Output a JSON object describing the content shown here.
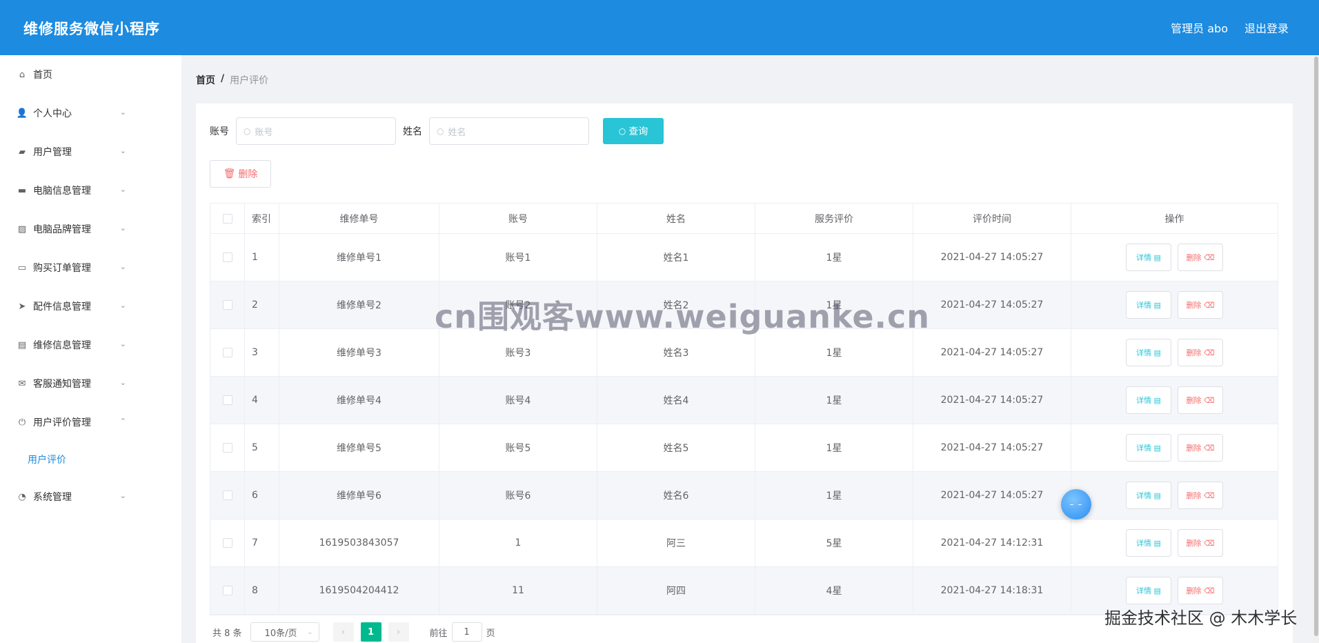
{
  "header": {
    "title": "维修服务微信小程序",
    "admin": "管理员 abo",
    "logout": "退出登录"
  },
  "sidebar": {
    "items": [
      {
        "label": "首页",
        "icon": "home-icon",
        "glyph": "⌂",
        "chevron": ""
      },
      {
        "label": "个人中心",
        "icon": "user-icon",
        "glyph": "👤",
        "chevron": "⌄"
      },
      {
        "label": "用户管理",
        "icon": "wallet-icon",
        "glyph": "▰",
        "chevron": "⌄"
      },
      {
        "label": "电脑信息管理",
        "icon": "briefcase-icon",
        "glyph": "▬",
        "chevron": "⌄"
      },
      {
        "label": "电脑品牌管理",
        "icon": "chart-icon",
        "glyph": "▨",
        "chevron": "⌄"
      },
      {
        "label": "购买订单管理",
        "icon": "ticket-icon",
        "glyph": "▭",
        "chevron": "⌄"
      },
      {
        "label": "配件信息管理",
        "icon": "send-icon",
        "glyph": "➤",
        "chevron": "⌄"
      },
      {
        "label": "维修信息管理",
        "icon": "clipboard-icon",
        "glyph": "▤",
        "chevron": "⌄"
      },
      {
        "label": "客服通知管理",
        "icon": "mail-icon",
        "glyph": "✉",
        "chevron": "⌄"
      },
      {
        "label": "用户评价管理",
        "icon": "power-icon",
        "glyph": "⏻",
        "chevron": "⌃"
      },
      {
        "label": "系统管理",
        "icon": "gauge-icon",
        "glyph": "◔",
        "chevron": "⌄"
      }
    ],
    "sub_item": "用户评价"
  },
  "breadcrumb": {
    "home": "首页",
    "sep": "/",
    "current": "用户评价"
  },
  "search": {
    "account_label": "账号",
    "account_placeholder": "账号",
    "name_label": "姓名",
    "name_placeholder": "姓名",
    "query_button": "查询",
    "delete_button": "删除"
  },
  "table": {
    "headers": [
      "索引",
      "维修单号",
      "账号",
      "姓名",
      "服务评价",
      "评价时间",
      "操作"
    ],
    "rows": [
      {
        "idx": "1",
        "no": "维修单号1",
        "account": "账号1",
        "name": "姓名1",
        "rating": "1星",
        "time": "2021-04-27 14:05:27"
      },
      {
        "idx": "2",
        "no": "维修单号2",
        "account": "账号2",
        "name": "姓名2",
        "rating": "1星",
        "time": "2021-04-27 14:05:27"
      },
      {
        "idx": "3",
        "no": "维修单号3",
        "account": "账号3",
        "name": "姓名3",
        "rating": "1星",
        "time": "2021-04-27 14:05:27"
      },
      {
        "idx": "4",
        "no": "维修单号4",
        "account": "账号4",
        "name": "姓名4",
        "rating": "1星",
        "time": "2021-04-27 14:05:27"
      },
      {
        "idx": "5",
        "no": "维修单号5",
        "account": "账号5",
        "name": "姓名5",
        "rating": "1星",
        "time": "2021-04-27 14:05:27"
      },
      {
        "idx": "6",
        "no": "维修单号6",
        "account": "账号6",
        "name": "姓名6",
        "rating": "1星",
        "time": "2021-04-27 14:05:27"
      },
      {
        "idx": "7",
        "no": "1619503843057",
        "account": "1",
        "name": "阿三",
        "rating": "5星",
        "time": "2021-04-27 14:12:31"
      },
      {
        "idx": "8",
        "no": "1619504204412",
        "account": "11",
        "name": "阿四",
        "rating": "4星",
        "time": "2021-04-27 14:18:31"
      }
    ],
    "detail_label": "详情 ▤",
    "remove_label": "删除 ⌫"
  },
  "pagination": {
    "total": "共 8 条",
    "page_size": "10条/页",
    "prev": "‹",
    "current_page": "1",
    "next": "›",
    "goto_label": "前往",
    "goto_value": "1",
    "page_suffix": "页"
  },
  "overlays": {
    "watermark": "cn围观客www.weiguanke.cn",
    "corner_text": "掘金技术社区 @ 木木学长"
  },
  "colors": {
    "header_bg": "#1c8be0",
    "query_btn": "#29c4d6",
    "active_page": "#00b98f",
    "danger": "#f56c6c"
  }
}
